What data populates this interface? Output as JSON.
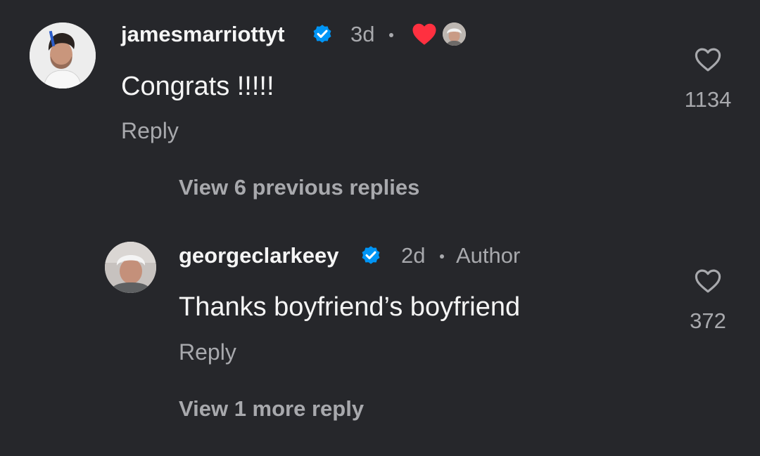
{
  "comment": {
    "username": "jamesmarriottyt",
    "verified": true,
    "time": "3d",
    "creator_liked": true,
    "creator_like_color": "#ff3040",
    "text": "Congrats !!!!!",
    "reply_label": "Reply",
    "likes": "1134",
    "avatar_icon": "person-avatar"
  },
  "view_previous_replies": "View 6 previous replies",
  "reply": {
    "username": "georgeclarkeey",
    "verified": true,
    "time": "2d",
    "badge": "Author",
    "text": "Thanks boyfriend’s boyfriend",
    "reply_label": "Reply",
    "likes": "372",
    "avatar_icon": "person-avatar"
  },
  "view_more_replies": "View 1 more reply",
  "colors": {
    "background": "#26272b",
    "verified": "#0095f6",
    "muted_text": "#a8a9ad",
    "primary_text": "#f5f5f5"
  }
}
